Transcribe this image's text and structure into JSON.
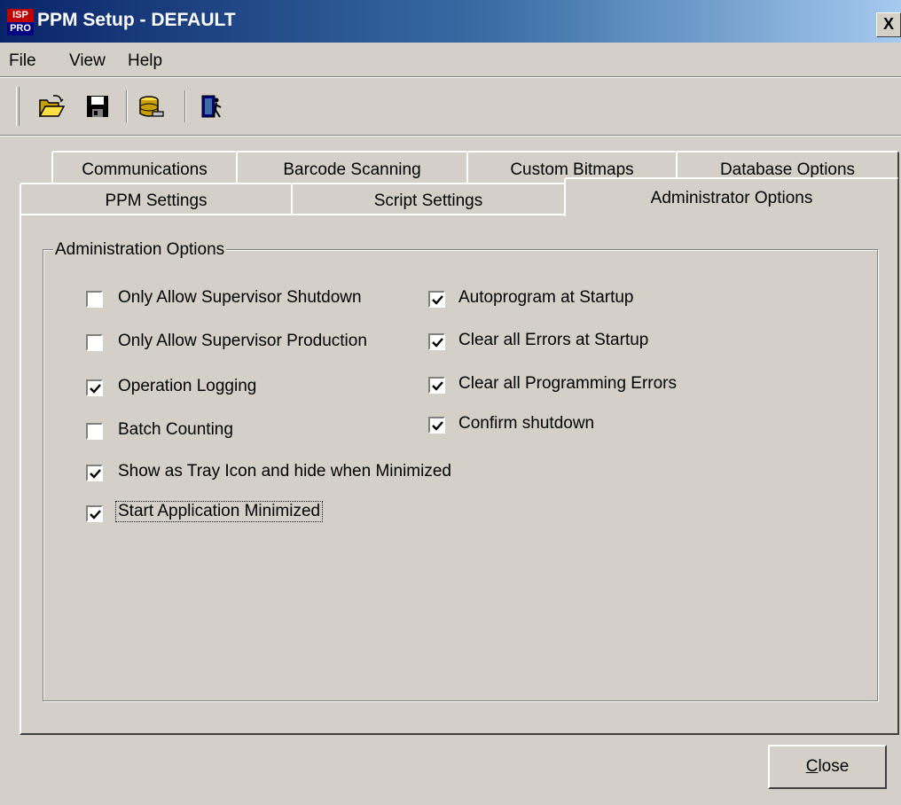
{
  "window": {
    "title": "PPM Setup - DEFAULT",
    "logo_top": "ISP",
    "logo_bottom": "PRO",
    "close_glyph": "X"
  },
  "menu": [
    "File",
    "View",
    "Help"
  ],
  "toolbar": {
    "buttons": [
      "open-folder-icon",
      "save-disk-icon",
      "database-icon",
      "exit-door-icon"
    ]
  },
  "tabs": {
    "row_back": [
      "Communications",
      "Barcode Scanning",
      "Custom Bitmaps",
      "Database Options"
    ],
    "row_front": [
      "PPM Settings",
      "Script Settings",
      "Administrator Options"
    ],
    "active": "Administrator Options"
  },
  "group": {
    "label": "Administration Options",
    "options": [
      {
        "label": "Only Allow Supervisor Shutdown",
        "checked": false
      },
      {
        "label": "Only Allow Supervisor Production",
        "checked": false
      },
      {
        "label": "Operation Logging",
        "checked": true
      },
      {
        "label": "Batch Counting",
        "checked": false
      },
      {
        "label": "Show as Tray Icon and hide when Minimized",
        "checked": true
      },
      {
        "label": "Start Application Minimized",
        "checked": true
      },
      {
        "label": "Autoprogram at Startup",
        "checked": true
      },
      {
        "label": "Clear all Errors at Startup",
        "checked": true
      },
      {
        "label": "Clear all Programming Errors",
        "checked": true
      },
      {
        "label": "Confirm shutdown",
        "checked": true
      }
    ]
  },
  "close_button": {
    "mnemonic": "C",
    "rest": "lose"
  }
}
